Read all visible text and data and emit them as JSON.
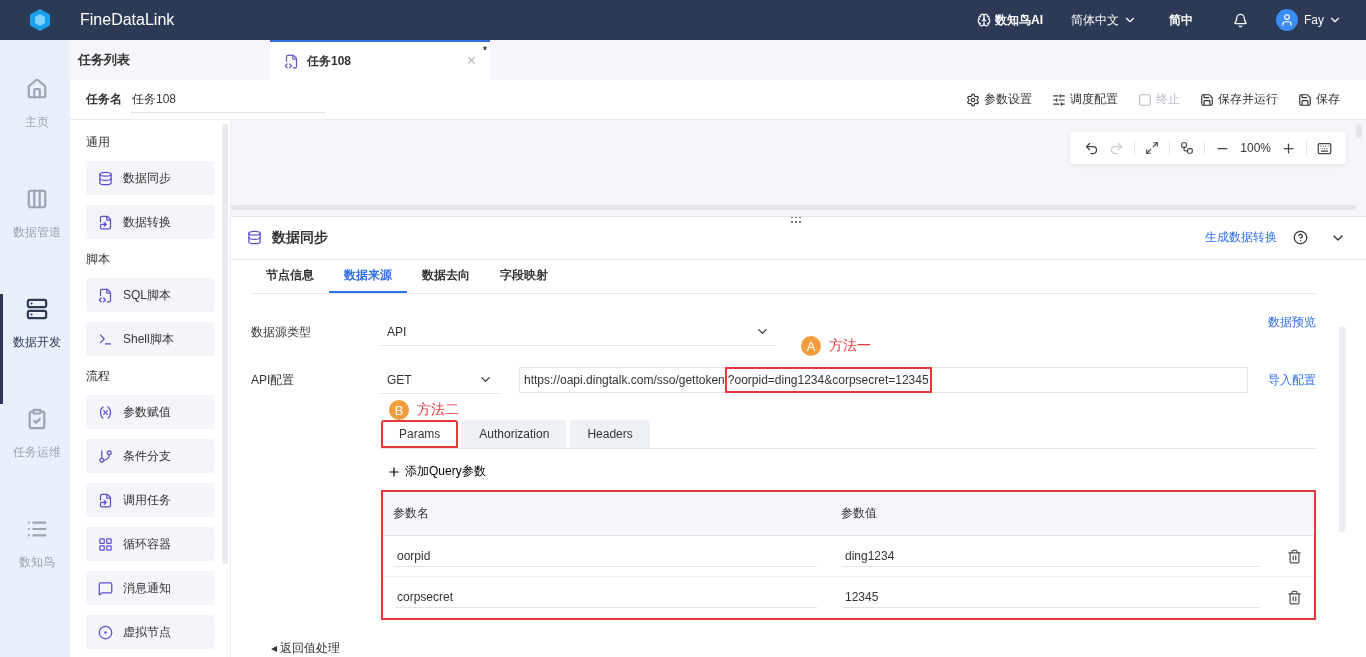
{
  "header": {
    "product": "FineDataLink",
    "ai": "数知鸟AI",
    "language": "简体中文",
    "lang_short": "简中",
    "user": "Fay"
  },
  "nav": [
    {
      "label": "主页",
      "selected": false
    },
    {
      "label": "数据管道",
      "selected": false
    },
    {
      "label": "数据开发",
      "selected": true
    },
    {
      "label": "任务运维",
      "selected": false
    },
    {
      "label": "数知鸟",
      "selected": false
    }
  ],
  "tab_bar": {
    "list_title": "任务列表",
    "tabs": [
      {
        "label": "任务108",
        "selected": true,
        "modified": "*",
        "close": "×"
      }
    ]
  },
  "task_name": {
    "label": "任务名",
    "value": "任务108"
  },
  "toolbar": [
    {
      "label": "参数设置",
      "disabled": false
    },
    {
      "label": "调度配置",
      "disabled": false
    },
    {
      "label": "终止",
      "disabled": true
    },
    {
      "label": "保存并运行",
      "disabled": false
    },
    {
      "label": "保存",
      "disabled": false
    }
  ],
  "palette": [
    {
      "title": "通用",
      "items": [
        "数据同步",
        "数据转换"
      ]
    },
    {
      "title": "脚本",
      "items": [
        "SQL脚本",
        "Shell脚本"
      ]
    },
    {
      "title": "流程",
      "items": [
        "参数赋值",
        "条件分支",
        "调用任务",
        "循环容器",
        "消息通知",
        "虚拟节点"
      ]
    }
  ],
  "canvas_tools": {
    "undo_disabled": false,
    "redo_disabled": true,
    "zoom": "100%"
  },
  "panel": {
    "title": "数据同步",
    "action": "生成数据转换",
    "tabs": [
      {
        "label": "节点信息",
        "selected": false
      },
      {
        "label": "数据来源",
        "selected": true
      },
      {
        "label": "数据去向",
        "selected": false
      },
      {
        "label": "字段映射",
        "selected": false
      }
    ],
    "source_type": {
      "label": "数据源类型",
      "value": "API",
      "link": "数据预览"
    },
    "api": {
      "label": "API配置",
      "method": "GET",
      "url_base": "https://oapi.dingtalk.com/sso/gettoken",
      "url_query": "?oorpid=ding1234&corpsecret=12345",
      "link": "导入配置"
    },
    "annotations": [
      {
        "badge": "A",
        "text": "方法一"
      },
      {
        "badge": "B",
        "text": "方法二"
      }
    ],
    "request_tabs": [
      {
        "label": "Params",
        "selected": true
      },
      {
        "label": "Authorization",
        "selected": false
      },
      {
        "label": "Headers",
        "selected": false
      }
    ],
    "add_param": "添加Query参数",
    "params": {
      "columns": [
        "参数名",
        "参数值"
      ],
      "rows": [
        {
          "name": "oorpid",
          "value": "ding1234"
        },
        {
          "name": "corpsecret",
          "value": "12345"
        }
      ]
    },
    "section_caret": "◂",
    "section": "返回值处理"
  }
}
